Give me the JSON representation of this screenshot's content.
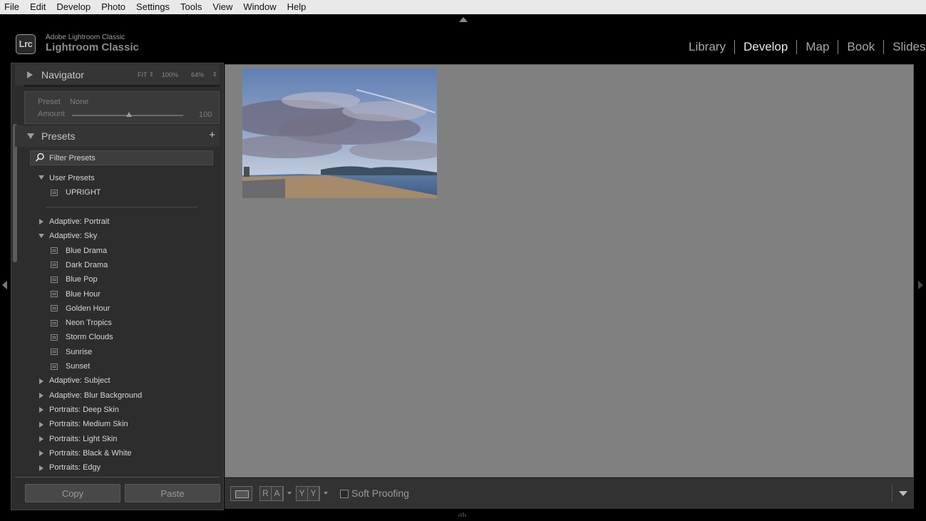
{
  "menubar": {
    "items": [
      "File",
      "Edit",
      "Develop",
      "Photo",
      "Settings",
      "Tools",
      "View",
      "Window",
      "Help"
    ]
  },
  "identity": {
    "logo_text": "Lrc",
    "small": "Adobe Lightroom Classic",
    "big": "Lightroom Classic"
  },
  "modules": {
    "items": [
      "Library",
      "Develop",
      "Map",
      "Book",
      "Slidesho"
    ],
    "active": "Develop"
  },
  "navigator": {
    "title": "Navigator",
    "zoom_fit": "FIT",
    "zoom_100": "100%",
    "zoom_custom": "64%"
  },
  "preset_preview": {
    "preset_label": "Preset",
    "preset_value": "None",
    "amount_label": "Amount",
    "amount_value": "100"
  },
  "presets": {
    "title": "Presets",
    "add_label": "+",
    "filter_placeholder": "Filter Presets",
    "user_presets": {
      "label": "User Presets",
      "items": [
        "UPRIGHT"
      ]
    },
    "adaptive_portrait": "Adaptive: Portrait",
    "adaptive_sky": {
      "label": "Adaptive: Sky",
      "items": [
        "Blue Drama",
        "Dark Drama",
        "Blue Pop",
        "Blue Hour",
        "Golden Hour",
        "Neon Tropics",
        "Storm Clouds",
        "Sunrise",
        "Sunset"
      ]
    },
    "collapsed_groups": [
      "Adaptive: Subject",
      "Adaptive: Blur Background",
      "Portraits: Deep Skin",
      "Portraits: Medium Skin",
      "Portraits: Light Skin",
      "Portraits: Black & White",
      "Portraits: Edgy"
    ]
  },
  "left_buttons": {
    "copy": "Copy",
    "paste": "Paste"
  },
  "toolbar": {
    "before_after_1": [
      "R",
      "A"
    ],
    "before_after_2": [
      "Y",
      "Y"
    ],
    "soft_proofing": "Soft Proofing"
  },
  "colors": {
    "canvas_gray": "#808080",
    "panel_bg": "#2d2d2d",
    "active_module": "#e8e8e8"
  }
}
